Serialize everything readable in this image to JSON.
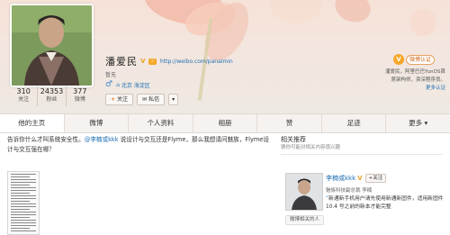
{
  "profile": {
    "name": "潘爱民",
    "vip_label": "ⓥ",
    "homepage_url": "http://weibo.com/panaimin",
    "intro": "暂无",
    "location": "北京 海淀区",
    "stats": [
      {
        "num": "310",
        "label": "关注"
      },
      {
        "num": "24353",
        "label": "粉丝"
      },
      {
        "num": "377",
        "label": "微博"
      }
    ],
    "follow_label": "关注",
    "message_label": "私信",
    "more_label": "▾"
  },
  "verify": {
    "label": "微博认证",
    "desc_line1": "潘爱民，阿里巴巴YunOS首",
    "desc_line2": "席架构师，资深程序员。",
    "more_link": "更多认证"
  },
  "tabs": [
    "他的主页",
    "微博",
    "个人资料",
    "相册",
    "赞",
    "足迹",
    "更多 ▾"
  ],
  "post": {
    "prefix": "告诉你什么才叫系统安全性。",
    "mention": "@李楠或kkk",
    "rest": " 说设计与交互还是Flyme，那么我想请问魅族，Flyme设计与交互强在哪？"
  },
  "related": {
    "title": "相关推荐",
    "subtitle": "猜你可能对相关内容感兴趣",
    "user_name": "李楠或kkk",
    "add_label": "+关注",
    "user_desc": "魅族科技副总裁 李楠",
    "post_text": "新通新手机用户请先使用新通新固件，适用新固件 10.4 号之前的新本才能完整",
    "footer": "微博相关的人"
  },
  "colors": {
    "accent": "#e57d21",
    "link": "#1d6eb3",
    "verify": "#f7a62a"
  }
}
